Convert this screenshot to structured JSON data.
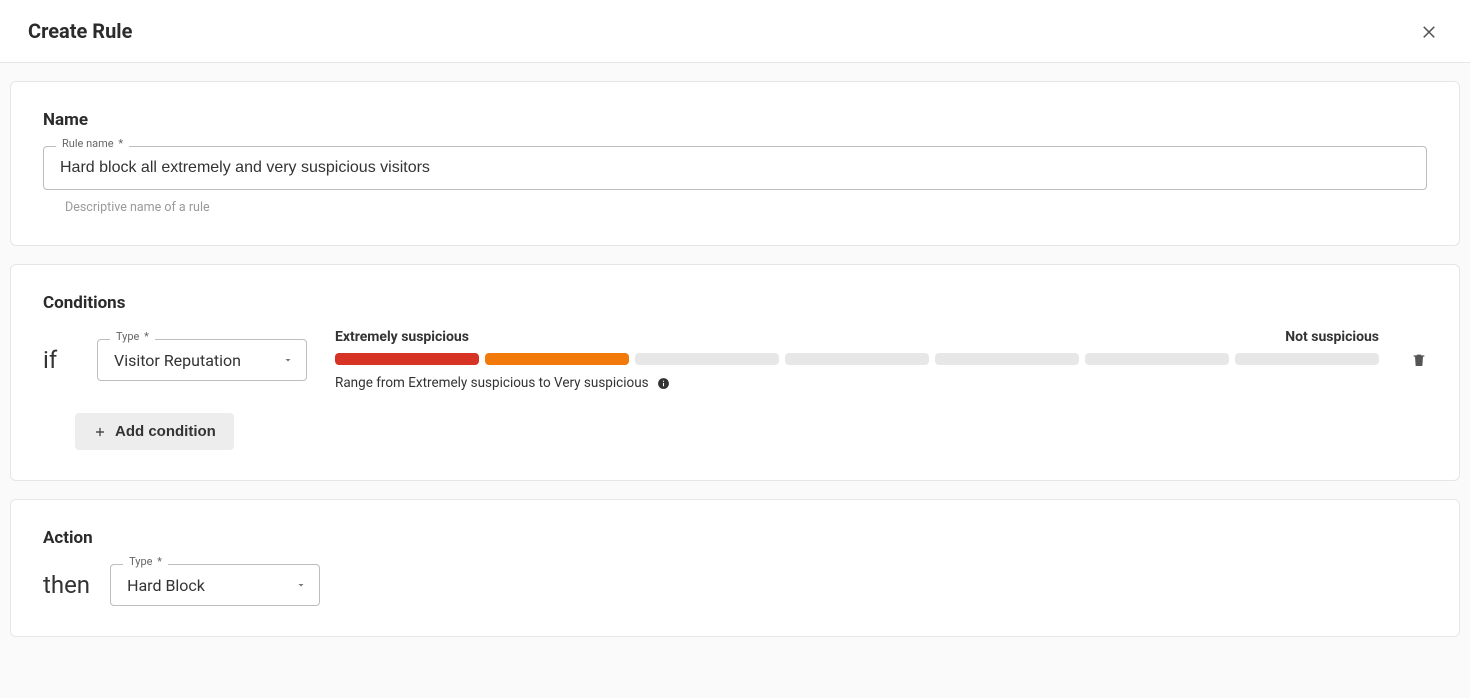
{
  "header": {
    "title": "Create Rule"
  },
  "nameSection": {
    "title": "Name",
    "fieldLabel": "Rule name",
    "required": "*",
    "value": "Hard block all extremely and very suspicious visitors",
    "helper": "Descriptive name of a rule"
  },
  "conditionsSection": {
    "title": "Conditions",
    "ifLabel": "if",
    "type": {
      "fieldLabel": "Type",
      "required": "*",
      "value": "Visitor Reputation"
    },
    "slider": {
      "leftLabel": "Extremely suspicious",
      "rightLabel": "Not suspicious",
      "rangeText": "Range from Extremely suspicious to Very suspicious"
    },
    "addConditionLabel": "Add condition"
  },
  "actionSection": {
    "title": "Action",
    "thenLabel": "then",
    "type": {
      "fieldLabel": "Type",
      "required": "*",
      "value": "Hard Block"
    }
  }
}
